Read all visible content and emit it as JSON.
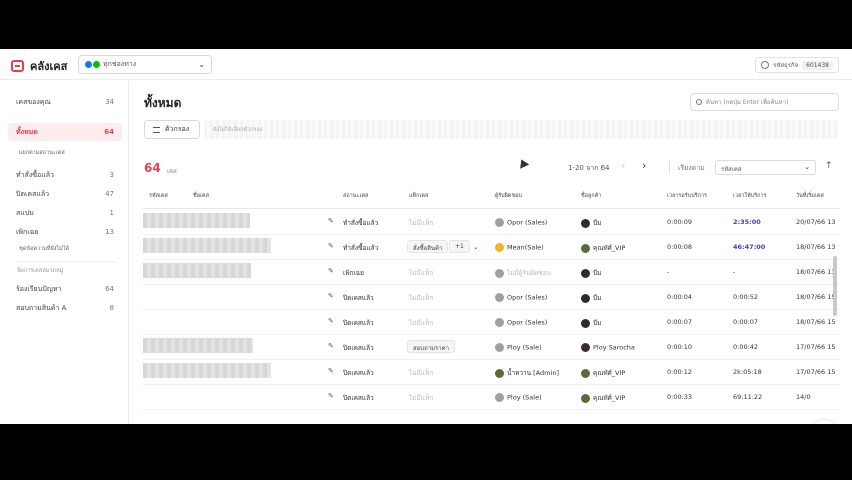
{
  "app": {
    "title": "คลังเคส"
  },
  "channel": {
    "label": "ทุกช่องทาง",
    "colors": [
      "#1877f2",
      "#00c300"
    ]
  },
  "business_code": {
    "label": "รหัสธุรกิจ",
    "value": "601438"
  },
  "sidebar": {
    "items": [
      {
        "label": "เคสของคุณ",
        "count": "34"
      },
      {
        "label": "ทั้งหมด",
        "count": "64"
      },
      {
        "label": "ทำสั่งซื้อแล้ว",
        "count": "3"
      },
      {
        "label": "ปิดเคสแล้ว",
        "count": "47"
      },
      {
        "label": "สแปม",
        "count": "1"
      },
      {
        "label": "เพิกเฉย",
        "count": "13"
      },
      {
        "label": "ร้องเรียนปัญหา",
        "count": "64"
      },
      {
        "label": "สอบถามสินค้า A",
        "count": "8"
      }
    ],
    "sub_all": "แยกตามสถานะเคส",
    "sub_dirty": "ชุดข้อความที่ยังไม่ได้",
    "group_label": "จัดการเคสหมวดหมู่"
  },
  "main": {
    "title": "ทั้งหมด",
    "search_placeholder": "ค้นหา (กดปุ่ม Enter เพื่อค้นหา)",
    "filter_label": "ตัวกรอง",
    "filter_hint": "ยังไม่ได้เลือกตัวกรอง",
    "total_count": "64",
    "total_unit": "เคส",
    "pager_text": "1-20 จาก 64",
    "sort_label": "เรียงตาม",
    "sort_value": "รหัสเคส",
    "accent": "#e0424f"
  },
  "table": {
    "headers": [
      "รหัสเคส",
      "ชื่อเคส",
      "สถานะเคส",
      "แท็กเคส",
      "ผู้รับผิดชอบ",
      "ชื่อลูกค้า",
      "เวลารอรับบริการ",
      "เวลาให้บริการ",
      "วันที่เริ่มเคส"
    ],
    "rows": [
      {
        "status": "ทำสั่งซื้อแล้ว",
        "tag": "ไม่มีแท็ก",
        "tag_faded": true,
        "agent": "Opor (Sales)",
        "agent_av": "sales",
        "customer": "บีม",
        "cust_av": "man",
        "wait": "0:00:09",
        "service": "2:35:00",
        "service_highlight": true,
        "date": "20/07/66 13"
      },
      {
        "status": "ทำสั่งซื้อแล้ว",
        "tag": "สั่งซื้อสินค้า",
        "tag_extra": "+1",
        "agent": "Mean(Sale)",
        "agent_av": "mean",
        "customer": "คุณทัศ์_VIP",
        "cust_av": "vip",
        "wait": "0:00:08",
        "service": "46:47:00",
        "service_highlight": true,
        "date": "18/07/66 13"
      },
      {
        "status": "เพิกเฉย",
        "tag": "ไม่มีแท็ก",
        "tag_faded": true,
        "agent": "ไม่มีผู้รับผิดชอบ",
        "agent_faded": true,
        "agent_av": "sales",
        "customer": "บีม",
        "cust_av": "man",
        "wait": "-",
        "service": "-",
        "date": "18/07/66 13"
      },
      {
        "status": "ปิดเคสแล้ว",
        "tag": "ไม่มีแท็ก",
        "tag_faded": true,
        "agent": "Opor (Sales)",
        "agent_av": "sales",
        "customer": "บีม",
        "cust_av": "man",
        "wait": "0:00:04",
        "service": "0:00:52",
        "date": "18/07/66 15"
      },
      {
        "status": "ปิดเคสแล้ว",
        "tag": "ไม่มีแท็ก",
        "tag_faded": true,
        "agent": "Opor (Sales)",
        "agent_av": "sales",
        "customer": "บีม",
        "cust_av": "man",
        "wait": "0:00:07",
        "service": "0:00:07",
        "date": "18/07/66 15"
      },
      {
        "status": "ปิดเคสแล้ว",
        "tag": "สอบถามราคา",
        "agent": "Ploy (Sale)",
        "agent_av": "sales",
        "customer": "Ploy Sarocha",
        "cust_av": "ploy",
        "wait": "0:00:10",
        "service": "0:00:42",
        "date": "17/07/66 15"
      },
      {
        "status": "ปิดเคสแล้ว",
        "tag": "ไม่มีแท็ก",
        "tag_faded": true,
        "agent": "น้ำหวาน [Admin]",
        "agent_av": "vip",
        "customer": "คุณทัศ์_VIP",
        "cust_av": "vip",
        "wait": "0:00:12",
        "service": "2k:05:18",
        "date": "17/07/66 15"
      },
      {
        "status": "ปิดเคสแล้ว",
        "tag": "ไม่มีแท็ก",
        "tag_faded": true,
        "agent": "Ploy (Sale)",
        "agent_av": "sales",
        "customer": "คุณทัศ์_VIP",
        "cust_av": "vip",
        "wait": "0:00:33",
        "service": "69:11:22",
        "date": "14/0"
      }
    ]
  }
}
